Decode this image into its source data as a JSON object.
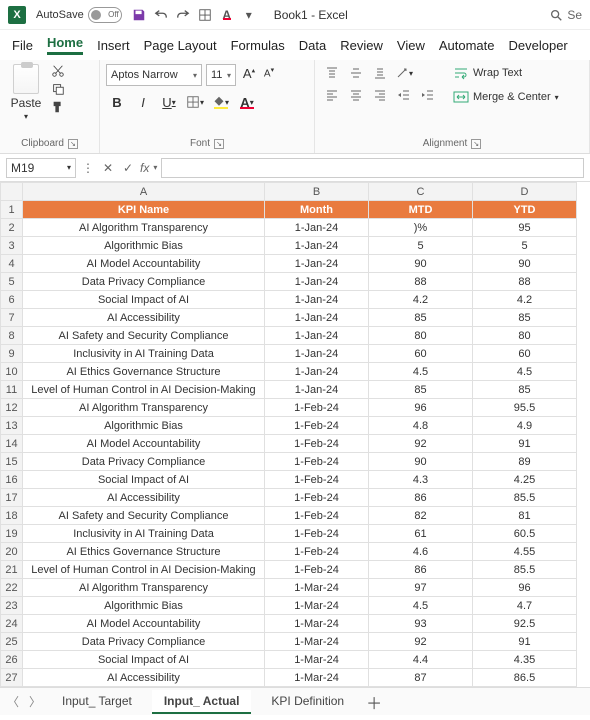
{
  "app": {
    "autosave_label": "AutoSave",
    "autosave_state": "Off",
    "doc_title": "Book1  -  Excel",
    "search_hint": "Se"
  },
  "menu": {
    "file": "File",
    "home": "Home",
    "insert": "Insert",
    "page_layout": "Page Layout",
    "formulas": "Formulas",
    "data": "Data",
    "review": "Review",
    "view": "View",
    "automate": "Automate",
    "developer": "Developer"
  },
  "ribbon": {
    "clipboard": {
      "paste": "Paste",
      "label": "Clipboard"
    },
    "font": {
      "name": "Aptos Narrow",
      "size": "11",
      "increase": "A",
      "decrease": "A",
      "bold": "B",
      "italic": "I",
      "underline": "U",
      "label": "Font"
    },
    "alignment": {
      "wrap": "Wrap Text",
      "merge": "Merge & Center",
      "label": "Alignment"
    }
  },
  "formula_bar": {
    "namebox": "M19",
    "fx": "fx",
    "value": ""
  },
  "columns": [
    "A",
    "B",
    "C",
    "D"
  ],
  "headers": {
    "A": "KPI Name",
    "B": "Month",
    "C": "MTD",
    "D": "YTD"
  },
  "rows": [
    {
      "n": 1,
      "A": "KPI Name",
      "B": "Month",
      "C": "MTD",
      "D": "YTD",
      "hdr": true
    },
    {
      "n": 2,
      "A": "AI Algorithm Transparency",
      "B": "1-Jan-24",
      "C": ")%",
      "D": "95"
    },
    {
      "n": 3,
      "A": "Algorithmic Bias",
      "B": "1-Jan-24",
      "C": "5",
      "D": "5"
    },
    {
      "n": 4,
      "A": "AI Model Accountability",
      "B": "1-Jan-24",
      "C": "90",
      "D": "90"
    },
    {
      "n": 5,
      "A": "Data Privacy Compliance",
      "B": "1-Jan-24",
      "C": "88",
      "D": "88"
    },
    {
      "n": 6,
      "A": "Social Impact of AI",
      "B": "1-Jan-24",
      "C": "4.2",
      "D": "4.2"
    },
    {
      "n": 7,
      "A": "AI Accessibility",
      "B": "1-Jan-24",
      "C": "85",
      "D": "85"
    },
    {
      "n": 8,
      "A": "AI Safety and Security Compliance",
      "B": "1-Jan-24",
      "C": "80",
      "D": "80"
    },
    {
      "n": 9,
      "A": "Inclusivity in AI Training Data",
      "B": "1-Jan-24",
      "C": "60",
      "D": "60"
    },
    {
      "n": 10,
      "A": "AI Ethics Governance Structure",
      "B": "1-Jan-24",
      "C": "4.5",
      "D": "4.5"
    },
    {
      "n": 11,
      "A": "Level of Human Control in AI Decision-Making",
      "B": "1-Jan-24",
      "C": "85",
      "D": "85"
    },
    {
      "n": 12,
      "A": "AI Algorithm Transparency",
      "B": "1-Feb-24",
      "C": "96",
      "D": "95.5"
    },
    {
      "n": 13,
      "A": "Algorithmic Bias",
      "B": "1-Feb-24",
      "C": "4.8",
      "D": "4.9"
    },
    {
      "n": 14,
      "A": "AI Model Accountability",
      "B": "1-Feb-24",
      "C": "92",
      "D": "91"
    },
    {
      "n": 15,
      "A": "Data Privacy Compliance",
      "B": "1-Feb-24",
      "C": "90",
      "D": "89"
    },
    {
      "n": 16,
      "A": "Social Impact of AI",
      "B": "1-Feb-24",
      "C": "4.3",
      "D": "4.25"
    },
    {
      "n": 17,
      "A": "AI Accessibility",
      "B": "1-Feb-24",
      "C": "86",
      "D": "85.5"
    },
    {
      "n": 18,
      "A": "AI Safety and Security Compliance",
      "B": "1-Feb-24",
      "C": "82",
      "D": "81"
    },
    {
      "n": 19,
      "A": "Inclusivity in AI Training Data",
      "B": "1-Feb-24",
      "C": "61",
      "D": "60.5"
    },
    {
      "n": 20,
      "A": "AI Ethics Governance Structure",
      "B": "1-Feb-24",
      "C": "4.6",
      "D": "4.55"
    },
    {
      "n": 21,
      "A": "Level of Human Control in AI Decision-Making",
      "B": "1-Feb-24",
      "C": "86",
      "D": "85.5"
    },
    {
      "n": 22,
      "A": "AI Algorithm Transparency",
      "B": "1-Mar-24",
      "C": "97",
      "D": "96"
    },
    {
      "n": 23,
      "A": "Algorithmic Bias",
      "B": "1-Mar-24",
      "C": "4.5",
      "D": "4.7"
    },
    {
      "n": 24,
      "A": "AI Model Accountability",
      "B": "1-Mar-24",
      "C": "93",
      "D": "92.5"
    },
    {
      "n": 25,
      "A": "Data Privacy Compliance",
      "B": "1-Mar-24",
      "C": "92",
      "D": "91"
    },
    {
      "n": 26,
      "A": "Social Impact of AI",
      "B": "1-Mar-24",
      "C": "4.4",
      "D": "4.35"
    },
    {
      "n": 27,
      "A": "AI Accessibility",
      "B": "1-Mar-24",
      "C": "87",
      "D": "86.5"
    }
  ],
  "tabs": {
    "t1": "Input_ Target",
    "t2": "Input_ Actual",
    "t3": "KPI Definition"
  }
}
